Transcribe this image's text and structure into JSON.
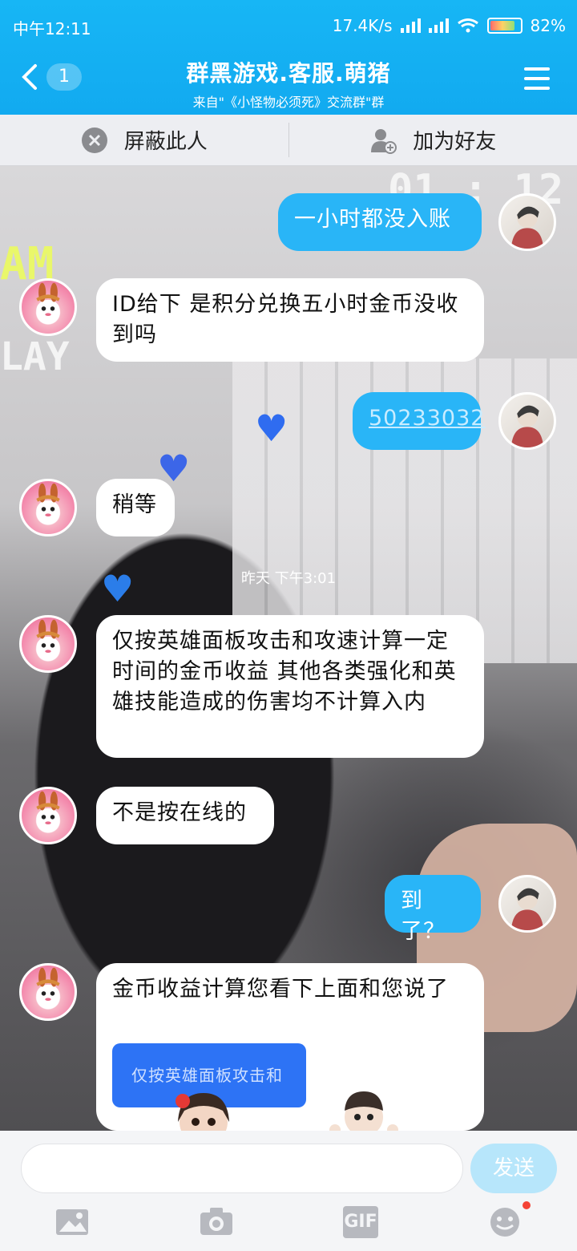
{
  "status_bar": {
    "time": "中午12:11",
    "net_speed": "17.4K/s",
    "battery": "82%"
  },
  "header": {
    "back_badge": "1",
    "title": "群黑游戏.客服.萌猪",
    "subtitle": "来自\"《小怪物必须死》交流群\"群"
  },
  "actions": {
    "block_label": "屏蔽此人",
    "add_friend_label": "加为好友"
  },
  "messages": [
    {
      "from": "me",
      "text": "一小时都没入账"
    },
    {
      "from": "other",
      "text": "ID给下 是积分兑换五小时金币没收到吗"
    },
    {
      "from": "me",
      "text": "50233032"
    },
    {
      "from": "other",
      "text": "稍等"
    },
    {
      "from": "other",
      "text": "仅按英雄面板攻击和攻速计算一定时间的金币收益 其他各类强化和英雄技能造成的伤害均不计算入内"
    },
    {
      "from": "other",
      "text": "不是按在线的"
    },
    {
      "from": "me",
      "text": "到了？"
    },
    {
      "from": "other",
      "text": "金币收益计算您看下上面和您说了"
    }
  ],
  "timestamp": "昨天 下午3:01",
  "quote_card_text": "仅按英雄面板攻击和",
  "input": {
    "placeholder": "",
    "send_label": "发送"
  },
  "toolbar": {
    "gif_label": "GIF",
    "icons": [
      "image-icon",
      "camera-icon",
      "gif-icon",
      "emoji-icon"
    ]
  },
  "colors": {
    "header": "#12aaf0",
    "my_bubble": "#29b5f7",
    "send_disabled": "#b7e6fb"
  }
}
